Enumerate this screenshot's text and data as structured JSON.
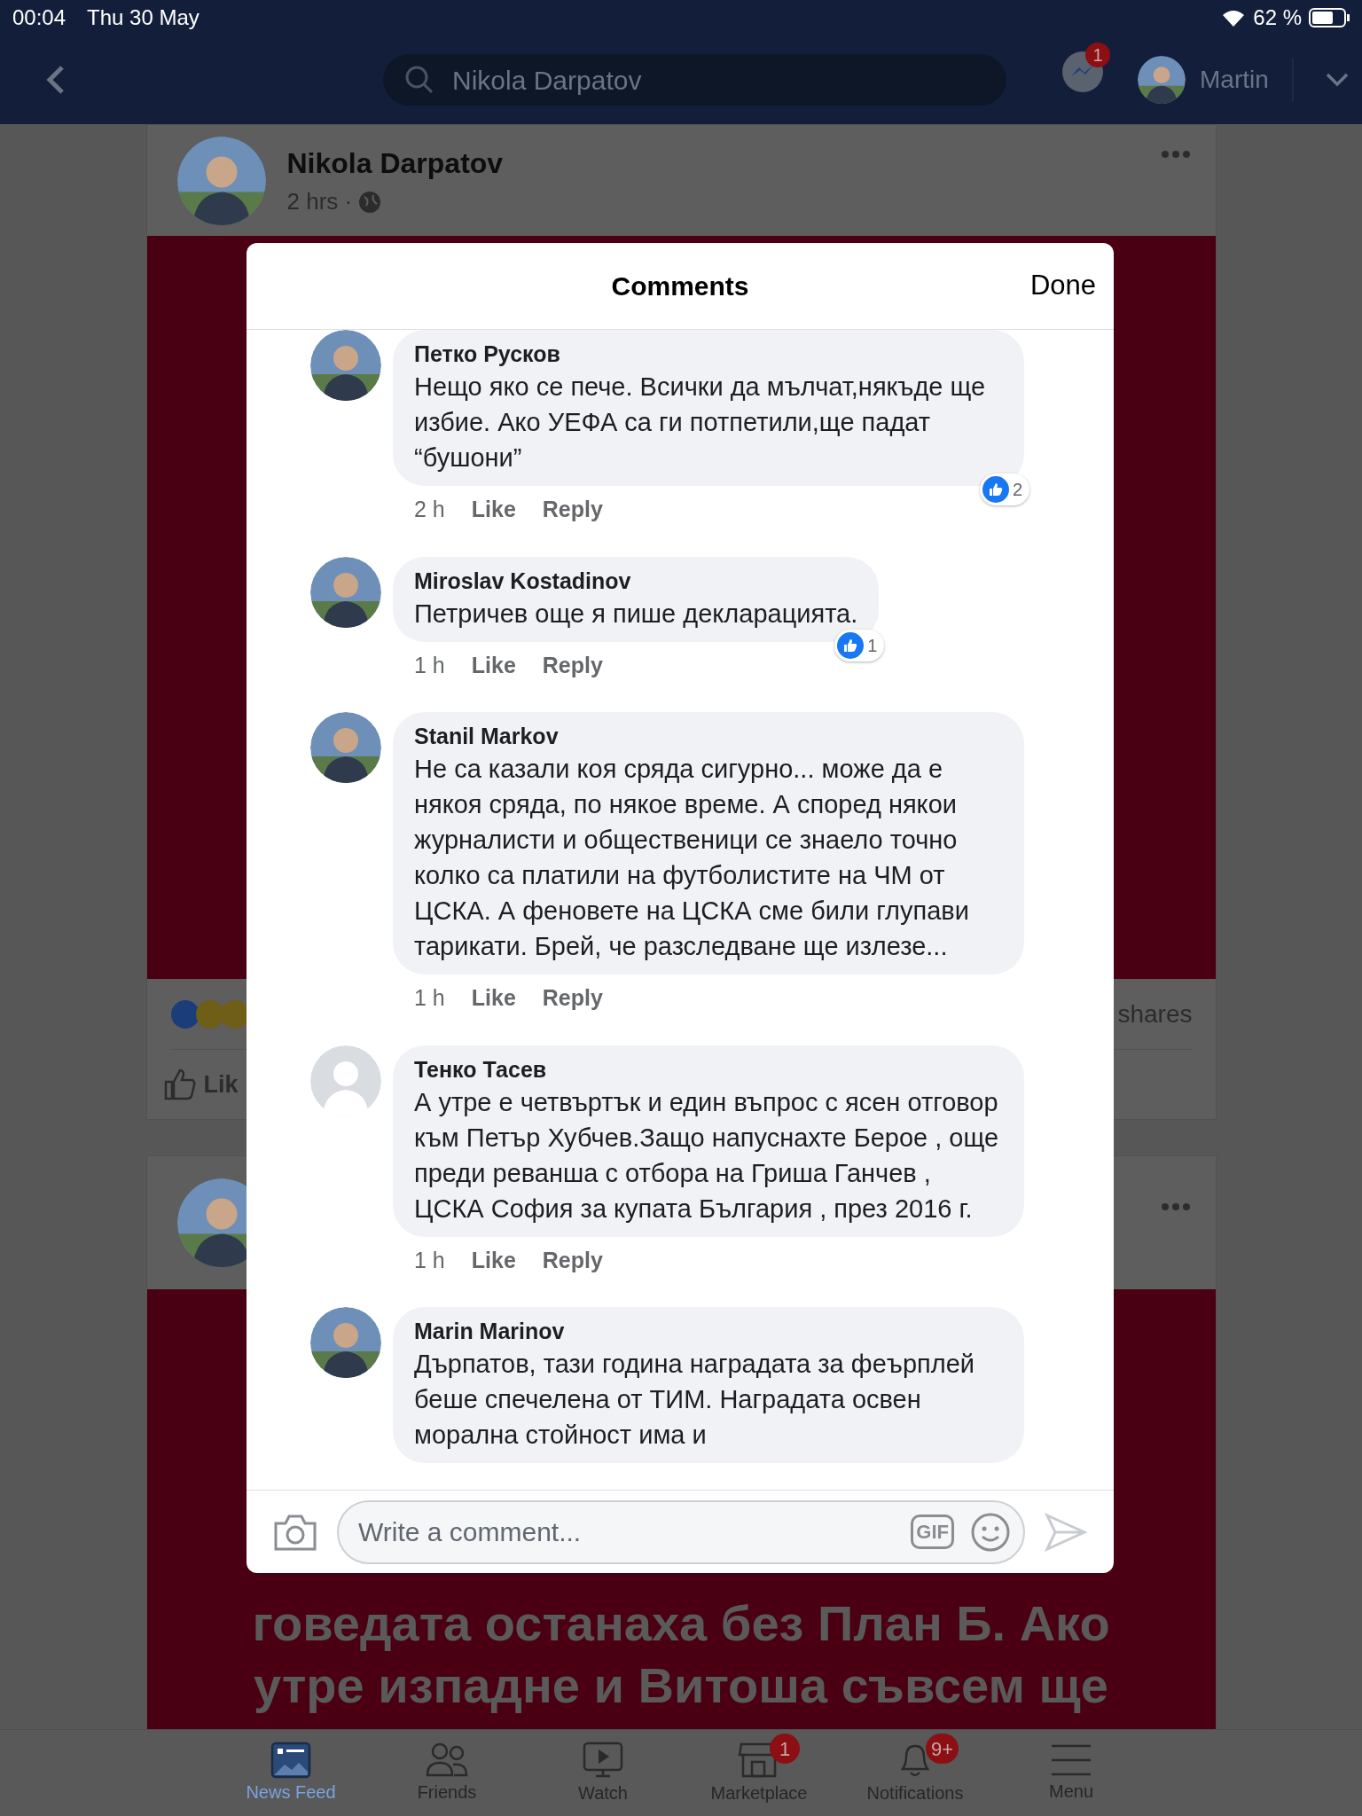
{
  "status_bar": {
    "time": "00:04",
    "date": "Thu 30 May",
    "battery": "62 %"
  },
  "nav_bar": {
    "search": {
      "value": "Nikola Darpatov"
    },
    "messenger_badge": "1",
    "user": "Martin"
  },
  "post": {
    "author": "Nikola Darpatov",
    "time": "2 hrs ·",
    "shares": "shares",
    "like_label": "Lik"
  },
  "post_2": {
    "image_lines": [
      "говедата останаха без План Б. Ако",
      "утре изпадне и Витоша съвсем ще"
    ]
  },
  "comments_sheet": {
    "title": "Comments",
    "done": "Done",
    "comments": [
      {
        "name": "Петко Русков",
        "text": "Нещо яко се пече. Всички да мълчат,някъде ще избие. Ако УЕФА са ги потпетили,ще падат “бушони”",
        "time": "2 h",
        "like": "Like",
        "reply": "Reply",
        "reactions": "2"
      },
      {
        "name": "Miroslav Kostadinov",
        "text": "Петричев още я пише декларацията.",
        "time": "1 h",
        "like": "Like",
        "reply": "Reply",
        "reactions": "1"
      },
      {
        "name": "Stanil Markov",
        "text": "Не са казали коя сряда сигурно... може да е някоя сряда, по някое време. А според някои журналисти и общественици се знаело точно колко са платили на футболистите на ЧМ от ЦСКА. А феновете на ЦСКА сме били глупави тарикати. Брей, че разследване ще излезе...",
        "time": "1 h",
        "like": "Like",
        "reply": "Reply"
      },
      {
        "name": "Тенко Тасев",
        "text": "А утре е четвъртък и един въпрос с ясен отговор към Петър Хубчев.Защо напуснахте Берое , още преди реванша с отбора на Гриша Ганчев , ЦСКА София за купата България , през 2016 г.",
        "time": "1 h",
        "like": "Like",
        "reply": "Reply",
        "default_avatar": true
      },
      {
        "name": "Marin Marinov",
        "text": "Дърпатов, тази година наградата за феърплей беше спечелена от ТИМ. Наградата освен морална стойност има и"
      }
    ],
    "composer": {
      "placeholder": "Write a comment...",
      "gif": "GIF"
    }
  },
  "tab_bar": [
    {
      "label": "News Feed",
      "selected": true,
      "kind": "feed"
    },
    {
      "label": "Friends",
      "selected": false,
      "kind": "friends"
    },
    {
      "label": "Watch",
      "selected": false,
      "kind": "watch"
    },
    {
      "label": "Marketplace",
      "selected": false,
      "kind": "market",
      "badge": "1"
    },
    {
      "label": "Notifications",
      "selected": false,
      "kind": "bell",
      "badge": "9+"
    },
    {
      "label": "Menu",
      "selected": false,
      "kind": "menu"
    }
  ]
}
